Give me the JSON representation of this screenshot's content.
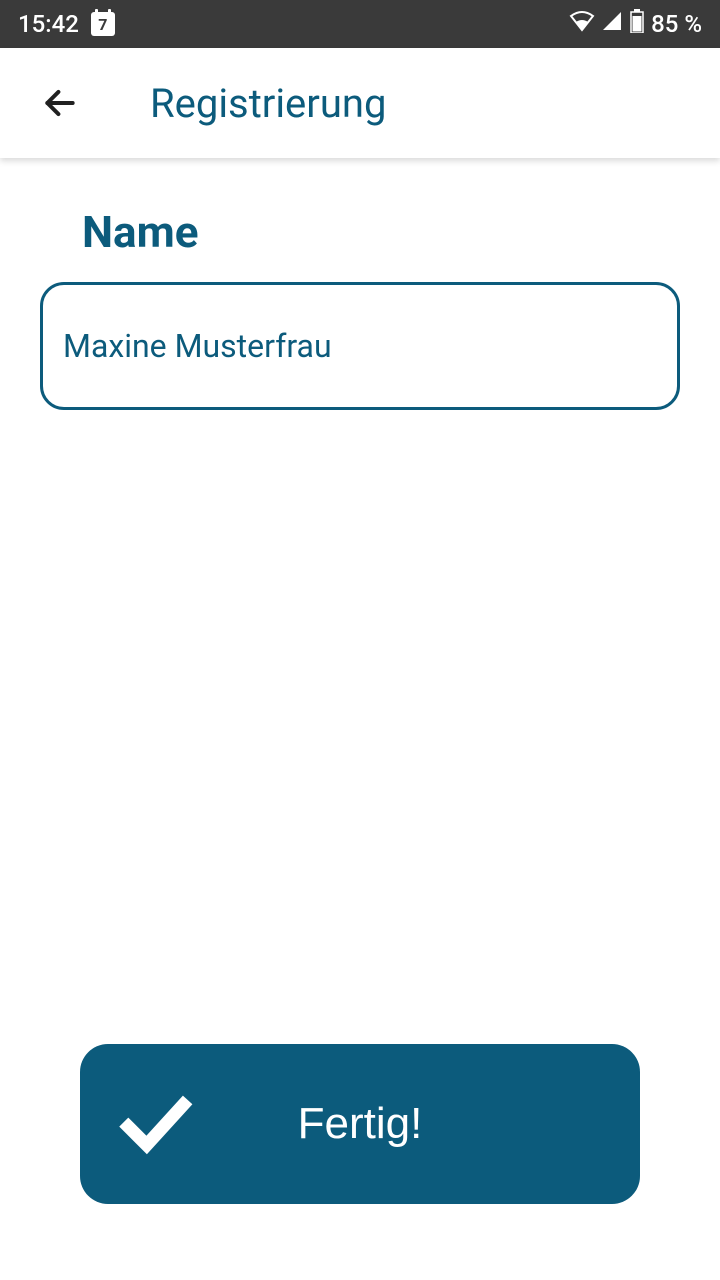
{
  "status_bar": {
    "time": "15:42",
    "calendar_day": "7",
    "battery": "85 %"
  },
  "app_bar": {
    "title": "Registrierung"
  },
  "form": {
    "name_label": "Name",
    "name_value": "Maxine Musterfrau"
  },
  "action": {
    "done_label": "Fertig!"
  },
  "colors": {
    "primary": "#0c5b7c",
    "status_bg": "#3a3a3a"
  }
}
